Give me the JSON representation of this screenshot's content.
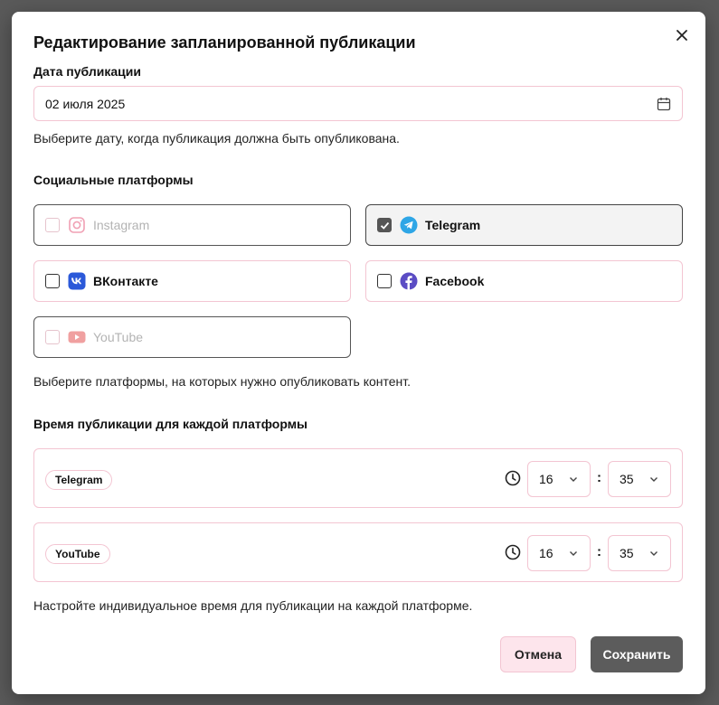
{
  "dialog": {
    "title": "Редактирование запланированной публикации",
    "close_icon": "close-icon"
  },
  "date": {
    "label": "Дата публикации",
    "value": "02 июля 2025",
    "hint": "Выберите дату, когда публикация должна быть опубликована.",
    "icon": "calendar-icon"
  },
  "platforms": {
    "label": "Социальные платформы",
    "hint": "Выберите платформы, на которых нужно опубликовать контент.",
    "items": [
      {
        "name": "Instagram",
        "checked": false,
        "disabled": true,
        "color": "#f0a0b4"
      },
      {
        "name": "Telegram",
        "checked": true,
        "disabled": false,
        "color": "#2ea6e6"
      },
      {
        "name": "ВКонтакте",
        "checked": false,
        "disabled": false,
        "color": "#2b59d9"
      },
      {
        "name": "Facebook",
        "checked": false,
        "disabled": false,
        "color": "#5b4cc4"
      },
      {
        "name": "YouTube",
        "checked": false,
        "disabled": true,
        "color": "#f0a0a0"
      }
    ]
  },
  "times": {
    "label": "Время публикации для каждой платформы",
    "hint": "Настройте индивидуальное время для публикации на каждой платформе.",
    "separator": ":",
    "rows": [
      {
        "platform": "Telegram",
        "hour": "16",
        "minute": "35"
      },
      {
        "platform": "YouTube",
        "hour": "16",
        "minute": "35"
      }
    ]
  },
  "actions": {
    "cancel": "Отмена",
    "save": "Сохранить"
  },
  "colors": {
    "accent_border": "#f3c5d2",
    "primary_button": "#5c5c5c",
    "cancel_button": "#fde5ec"
  }
}
